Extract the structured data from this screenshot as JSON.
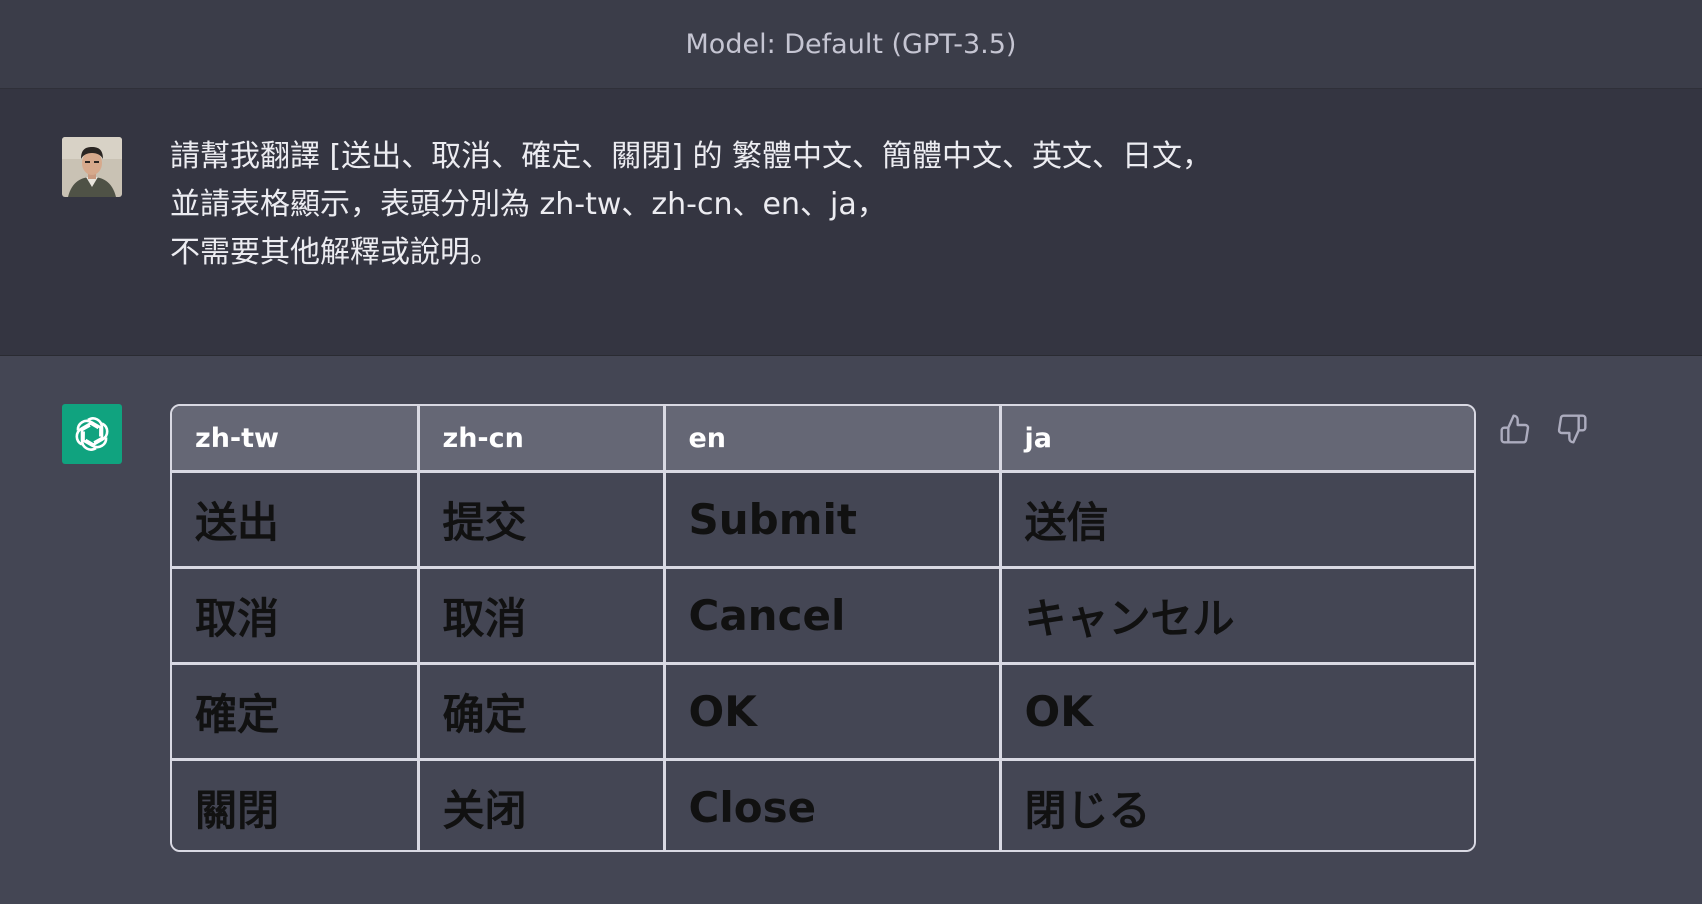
{
  "header": {
    "model_label": "Model: Default (GPT-3.5)"
  },
  "user_message": {
    "avatar": "user-avatar",
    "lines": [
      "請幫我翻譯 [送出、取消、確定、關閉] 的 繁體中文、簡體中文、英文、日文，",
      "並請表格顯示，表頭分別為 zh-tw、zh-cn、en、ja，",
      "不需要其他解釋或說明。"
    ]
  },
  "assistant_message": {
    "avatar": "openai-logo",
    "table": {
      "headers": [
        "zh-tw",
        "zh-cn",
        "en",
        "ja"
      ],
      "rows": [
        [
          "送出",
          "提交",
          "Submit",
          "送信"
        ],
        [
          "取消",
          "取消",
          "Cancel",
          "キャンセル"
        ],
        [
          "確定",
          "确定",
          "OK",
          "OK"
        ],
        [
          "關閉",
          "关闭",
          "Close",
          "閉じる"
        ]
      ]
    },
    "feedback_icons": [
      "thumbs-up-icon",
      "thumbs-down-icon"
    ]
  },
  "colors": {
    "top_bar": "#3b3d49",
    "user_bg": "#343541",
    "assistant_bg": "#444654",
    "header_row_bg": "#656775",
    "openai_green": "#10a37f",
    "table_border": "#d9d9e3"
  }
}
